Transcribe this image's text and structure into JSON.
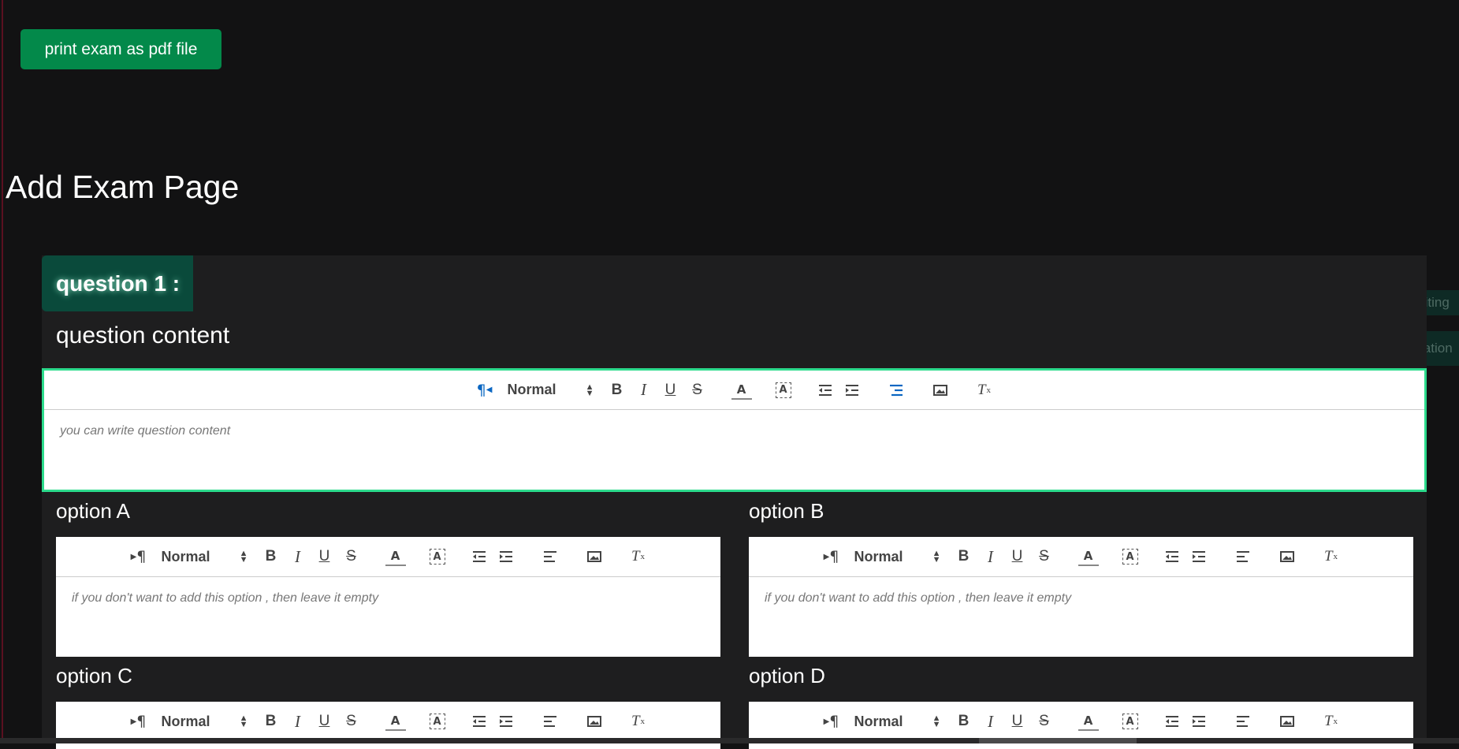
{
  "header": {
    "print_button": "print exam as pdf file"
  },
  "page_title": "Add Exam Page",
  "floating": {
    "images_equation": "images & equation editing",
    "add_equation": "add equation"
  },
  "question": {
    "badge": "question 1 :",
    "content_label": "question content",
    "content_placeholder": "you can write question content",
    "options": [
      {
        "label": "option A",
        "placeholder": "if you don't want to add this option , then leave it empty"
      },
      {
        "label": "option B",
        "placeholder": "if you don't want to add this option , then leave it empty"
      },
      {
        "label": "option C",
        "placeholder": ""
      },
      {
        "label": "option D",
        "placeholder": ""
      }
    ]
  },
  "toolbar": {
    "direction": "¶",
    "header_select": "Normal",
    "bold": "B",
    "italic": "I",
    "underline": "U",
    "strike": "S",
    "color": "A",
    "background": "A",
    "clean": "T"
  },
  "icons": [
    "direction-rtl-icon",
    "bold-icon",
    "italic-icon",
    "underline-icon",
    "strike-icon",
    "text-color-icon",
    "background-color-icon",
    "outdent-icon",
    "indent-icon",
    "align-icon",
    "image-icon",
    "clear-format-icon"
  ],
  "colors": {
    "background": "#121213",
    "card": "#1e1e1f",
    "accent": "#03894a",
    "focus_border": "#2cdb8c",
    "badge": "#0a4a3b",
    "active_icon": "#0a66c2"
  }
}
